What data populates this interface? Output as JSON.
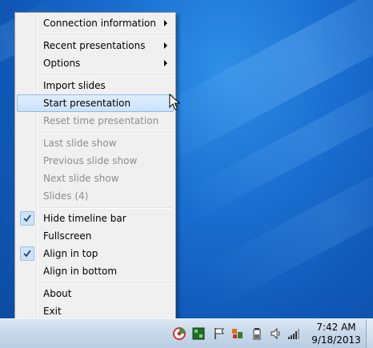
{
  "menu": {
    "items": [
      {
        "label": "Connection information",
        "submenu": true,
        "enabled": true,
        "checked": false
      },
      {
        "label": "Recent presentations",
        "submenu": true,
        "enabled": true,
        "checked": false
      },
      {
        "label": "Options",
        "submenu": true,
        "enabled": true,
        "checked": false
      },
      {
        "label": "Import slides",
        "submenu": false,
        "enabled": true,
        "checked": false
      },
      {
        "label": "Start presentation",
        "submenu": false,
        "enabled": true,
        "checked": false,
        "highlighted": true
      },
      {
        "label": "Reset time presentation",
        "submenu": false,
        "enabled": false,
        "checked": false
      },
      {
        "label": "Last slide show",
        "submenu": false,
        "enabled": false,
        "checked": false
      },
      {
        "label": "Previous slide show",
        "submenu": false,
        "enabled": false,
        "checked": false
      },
      {
        "label": "Next slide show",
        "submenu": false,
        "enabled": false,
        "checked": false
      },
      {
        "label": "Slides (4)",
        "submenu": false,
        "enabled": false,
        "checked": false
      },
      {
        "label": "Hide timeline bar",
        "submenu": false,
        "enabled": true,
        "checked": true
      },
      {
        "label": "Fullscreen",
        "submenu": false,
        "enabled": true,
        "checked": false
      },
      {
        "label": "Align in top",
        "submenu": false,
        "enabled": true,
        "checked": true
      },
      {
        "label": "Align in bottom",
        "submenu": false,
        "enabled": true,
        "checked": false
      },
      {
        "label": "About",
        "submenu": false,
        "enabled": true,
        "checked": false
      },
      {
        "label": "Exit",
        "submenu": false,
        "enabled": true,
        "checked": false
      }
    ]
  },
  "taskbar": {
    "clock": {
      "time": "7:42 AM",
      "date": "9/18/2013"
    },
    "tray_icons": [
      "app-tray-icon",
      "green-app-icon",
      "action-center-flag-icon",
      "network-icon",
      "battery-icon",
      "volume-icon",
      "signal-bars-icon"
    ]
  },
  "colors": {
    "desktop": "#1a6fd1",
    "menu_background": "#f0f0f0",
    "highlight": "#cbe3fb",
    "disabled_text": "#8d8d8d"
  }
}
